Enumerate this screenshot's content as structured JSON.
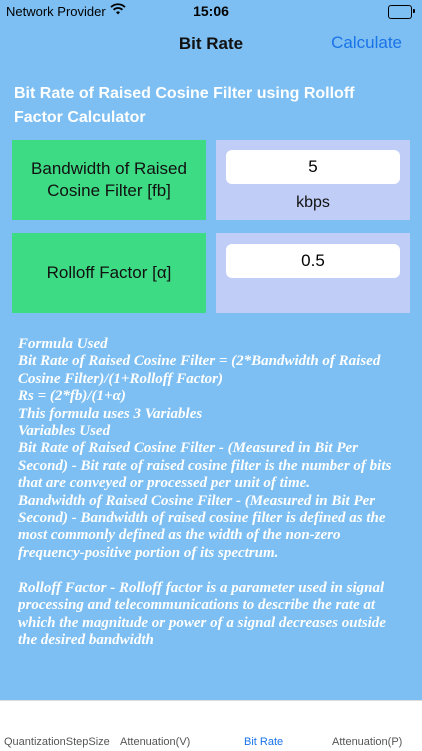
{
  "status": {
    "carrier": "Network Provider",
    "time": "15:06"
  },
  "nav": {
    "title": "Bit Rate",
    "action": "Calculate"
  },
  "heading": "Bit Rate of Raised Cosine Filter using Rolloff Factor Calculator",
  "inputs": [
    {
      "label": "Bandwidth of Raised Cosine Filter [fb]",
      "value": "5",
      "unit": "kbps"
    },
    {
      "label": "Rolloff Factor [α]",
      "value": "0.5",
      "unit": ""
    }
  ],
  "formula_text": "Formula Used\nBit Rate of Raised Cosine Filter = (2*Bandwidth of Raised Cosine Filter)/(1+Rolloff Factor)\nRs = (2*fb)/(1+α)\nThis formula uses 3 Variables\nVariables Used\nBit Rate of Raised Cosine Filter - (Measured in Bit Per Second) - Bit rate of raised cosine filter is the number of bits that are conveyed or processed per unit of time.\nBandwidth of Raised Cosine Filter - (Measured in Bit Per Second) - Bandwidth of raised cosine filter is defined as the most commonly defined as the width of the non-zero frequency-positive portion of its spectrum.\n\nRolloff Factor - Rolloff factor is a parameter used in signal processing and telecommunications to describe the rate at which the magnitude or power of a signal decreases outside the desired bandwidth",
  "tabs": [
    {
      "label": "QuantizationStepSize",
      "active": false
    },
    {
      "label": "Attenuation(V)",
      "active": false
    },
    {
      "label": "Bit Rate",
      "active": true
    },
    {
      "label": "Attenuation(P)",
      "active": false
    }
  ],
  "colors": {
    "background": "#7dbff2",
    "label_box": "#3ddc84",
    "input_box": "#c0cdf7",
    "accent": "#1a73e8"
  }
}
